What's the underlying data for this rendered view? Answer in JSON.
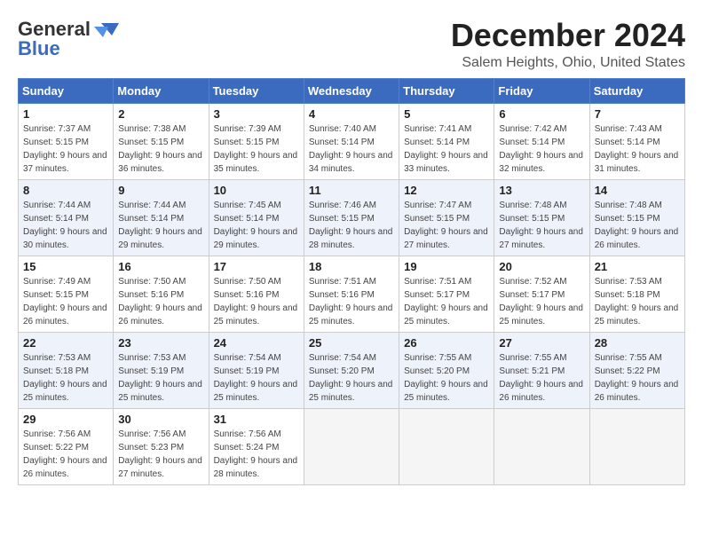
{
  "header": {
    "logo_line1": "General",
    "logo_line2": "Blue",
    "month": "December 2024",
    "location": "Salem Heights, Ohio, United States"
  },
  "weekdays": [
    "Sunday",
    "Monday",
    "Tuesday",
    "Wednesday",
    "Thursday",
    "Friday",
    "Saturday"
  ],
  "weeks": [
    [
      {
        "day": "1",
        "sunrise": "Sunrise: 7:37 AM",
        "sunset": "Sunset: 5:15 PM",
        "daylight": "Daylight: 9 hours and 37 minutes."
      },
      {
        "day": "2",
        "sunrise": "Sunrise: 7:38 AM",
        "sunset": "Sunset: 5:15 PM",
        "daylight": "Daylight: 9 hours and 36 minutes."
      },
      {
        "day": "3",
        "sunrise": "Sunrise: 7:39 AM",
        "sunset": "Sunset: 5:15 PM",
        "daylight": "Daylight: 9 hours and 35 minutes."
      },
      {
        "day": "4",
        "sunrise": "Sunrise: 7:40 AM",
        "sunset": "Sunset: 5:14 PM",
        "daylight": "Daylight: 9 hours and 34 minutes."
      },
      {
        "day": "5",
        "sunrise": "Sunrise: 7:41 AM",
        "sunset": "Sunset: 5:14 PM",
        "daylight": "Daylight: 9 hours and 33 minutes."
      },
      {
        "day": "6",
        "sunrise": "Sunrise: 7:42 AM",
        "sunset": "Sunset: 5:14 PM",
        "daylight": "Daylight: 9 hours and 32 minutes."
      },
      {
        "day": "7",
        "sunrise": "Sunrise: 7:43 AM",
        "sunset": "Sunset: 5:14 PM",
        "daylight": "Daylight: 9 hours and 31 minutes."
      }
    ],
    [
      {
        "day": "8",
        "sunrise": "Sunrise: 7:44 AM",
        "sunset": "Sunset: 5:14 PM",
        "daylight": "Daylight: 9 hours and 30 minutes."
      },
      {
        "day": "9",
        "sunrise": "Sunrise: 7:44 AM",
        "sunset": "Sunset: 5:14 PM",
        "daylight": "Daylight: 9 hours and 29 minutes."
      },
      {
        "day": "10",
        "sunrise": "Sunrise: 7:45 AM",
        "sunset": "Sunset: 5:14 PM",
        "daylight": "Daylight: 9 hours and 29 minutes."
      },
      {
        "day": "11",
        "sunrise": "Sunrise: 7:46 AM",
        "sunset": "Sunset: 5:15 PM",
        "daylight": "Daylight: 9 hours and 28 minutes."
      },
      {
        "day": "12",
        "sunrise": "Sunrise: 7:47 AM",
        "sunset": "Sunset: 5:15 PM",
        "daylight": "Daylight: 9 hours and 27 minutes."
      },
      {
        "day": "13",
        "sunrise": "Sunrise: 7:48 AM",
        "sunset": "Sunset: 5:15 PM",
        "daylight": "Daylight: 9 hours and 27 minutes."
      },
      {
        "day": "14",
        "sunrise": "Sunrise: 7:48 AM",
        "sunset": "Sunset: 5:15 PM",
        "daylight": "Daylight: 9 hours and 26 minutes."
      }
    ],
    [
      {
        "day": "15",
        "sunrise": "Sunrise: 7:49 AM",
        "sunset": "Sunset: 5:15 PM",
        "daylight": "Daylight: 9 hours and 26 minutes."
      },
      {
        "day": "16",
        "sunrise": "Sunrise: 7:50 AM",
        "sunset": "Sunset: 5:16 PM",
        "daylight": "Daylight: 9 hours and 26 minutes."
      },
      {
        "day": "17",
        "sunrise": "Sunrise: 7:50 AM",
        "sunset": "Sunset: 5:16 PM",
        "daylight": "Daylight: 9 hours and 25 minutes."
      },
      {
        "day": "18",
        "sunrise": "Sunrise: 7:51 AM",
        "sunset": "Sunset: 5:16 PM",
        "daylight": "Daylight: 9 hours and 25 minutes."
      },
      {
        "day": "19",
        "sunrise": "Sunrise: 7:51 AM",
        "sunset": "Sunset: 5:17 PM",
        "daylight": "Daylight: 9 hours and 25 minutes."
      },
      {
        "day": "20",
        "sunrise": "Sunrise: 7:52 AM",
        "sunset": "Sunset: 5:17 PM",
        "daylight": "Daylight: 9 hours and 25 minutes."
      },
      {
        "day": "21",
        "sunrise": "Sunrise: 7:53 AM",
        "sunset": "Sunset: 5:18 PM",
        "daylight": "Daylight: 9 hours and 25 minutes."
      }
    ],
    [
      {
        "day": "22",
        "sunrise": "Sunrise: 7:53 AM",
        "sunset": "Sunset: 5:18 PM",
        "daylight": "Daylight: 9 hours and 25 minutes."
      },
      {
        "day": "23",
        "sunrise": "Sunrise: 7:53 AM",
        "sunset": "Sunset: 5:19 PM",
        "daylight": "Daylight: 9 hours and 25 minutes."
      },
      {
        "day": "24",
        "sunrise": "Sunrise: 7:54 AM",
        "sunset": "Sunset: 5:19 PM",
        "daylight": "Daylight: 9 hours and 25 minutes."
      },
      {
        "day": "25",
        "sunrise": "Sunrise: 7:54 AM",
        "sunset": "Sunset: 5:20 PM",
        "daylight": "Daylight: 9 hours and 25 minutes."
      },
      {
        "day": "26",
        "sunrise": "Sunrise: 7:55 AM",
        "sunset": "Sunset: 5:20 PM",
        "daylight": "Daylight: 9 hours and 25 minutes."
      },
      {
        "day": "27",
        "sunrise": "Sunrise: 7:55 AM",
        "sunset": "Sunset: 5:21 PM",
        "daylight": "Daylight: 9 hours and 26 minutes."
      },
      {
        "day": "28",
        "sunrise": "Sunrise: 7:55 AM",
        "sunset": "Sunset: 5:22 PM",
        "daylight": "Daylight: 9 hours and 26 minutes."
      }
    ],
    [
      {
        "day": "29",
        "sunrise": "Sunrise: 7:56 AM",
        "sunset": "Sunset: 5:22 PM",
        "daylight": "Daylight: 9 hours and 26 minutes."
      },
      {
        "day": "30",
        "sunrise": "Sunrise: 7:56 AM",
        "sunset": "Sunset: 5:23 PM",
        "daylight": "Daylight: 9 hours and 27 minutes."
      },
      {
        "day": "31",
        "sunrise": "Sunrise: 7:56 AM",
        "sunset": "Sunset: 5:24 PM",
        "daylight": "Daylight: 9 hours and 28 minutes."
      },
      null,
      null,
      null,
      null
    ]
  ]
}
